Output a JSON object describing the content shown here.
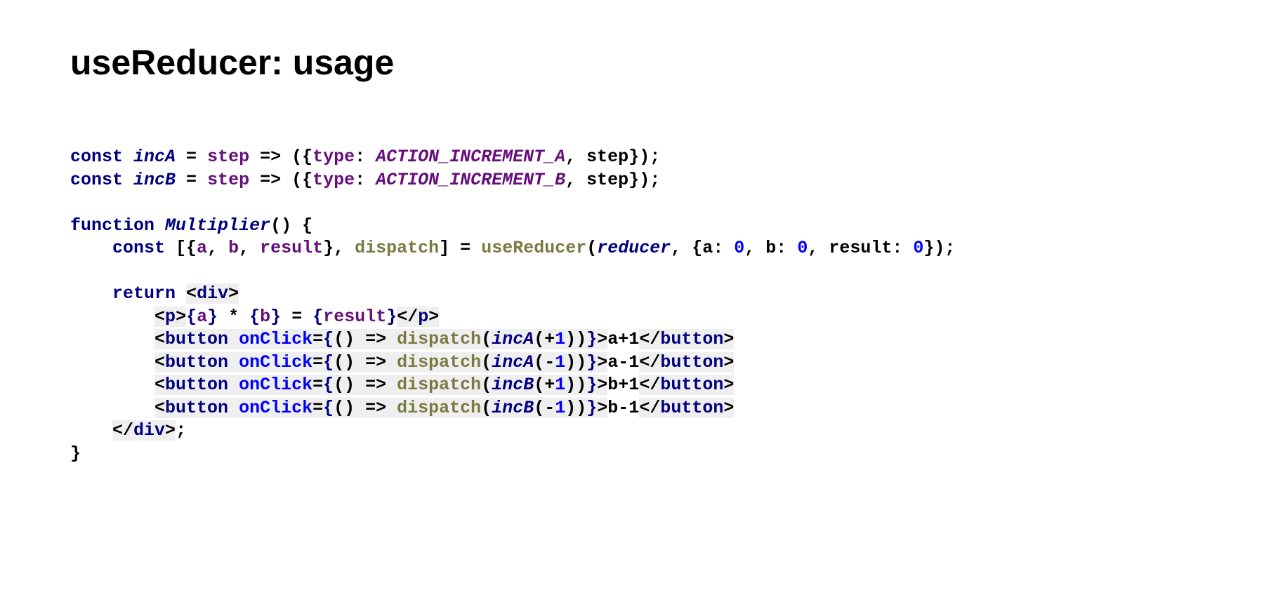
{
  "title": "useReducer: usage",
  "code": {
    "l1": {
      "const": "const",
      "fn": "incA",
      "eq": " = ",
      "param": "step",
      "arrow": " => ({",
      "type": "type",
      "colon": ": ",
      "action": "ACTION_INCREMENT_A",
      "rest": ", step});"
    },
    "l2": {
      "const": "const",
      "fn": "incB",
      "eq": " = ",
      "param": "step",
      "arrow": " => ({",
      "type": "type",
      "colon": ": ",
      "action": "ACTION_INCREMENT_B",
      "rest": ", step});"
    },
    "l4": {
      "function": "function",
      "name": "Multiplier",
      "after": "() {"
    },
    "l5": {
      "indent": "    ",
      "const": "const",
      "open": " [{",
      "a": "a",
      "c1": ", ",
      "b": "b",
      "c2": ", ",
      "result": "result",
      "close": "}, ",
      "dispatch": "dispatch",
      "eq": "] = ",
      "useReducer": "useReducer",
      "lp": "(",
      "reducer": "reducer",
      "c3": ", {a: ",
      "n0a": "0",
      "c4": ", b: ",
      "n0b": "0",
      "c5": ", result: ",
      "n0c": "0",
      "rp": "});"
    },
    "l7": {
      "indent": "    ",
      "return": "return",
      "sp": " ",
      "lt": "<",
      "div": "div",
      "gt": ">"
    },
    "l8": {
      "indent": "        ",
      "lt1": "<",
      "p": "p",
      "gt1": ">",
      "ob1": "{",
      "a": "a",
      "cb1": "}",
      "star": " * ",
      "ob2": "{",
      "b": "b",
      "cb2": "}",
      "eq": " = ",
      "ob3": "{",
      "result": "result",
      "cb3": "}",
      "lt2": "</",
      "p2": "p",
      "gt2": ">"
    },
    "btn1": {
      "indent": "        ",
      "lt": "<",
      "button": "button",
      "sp": " ",
      "onClick": "onClick",
      "eq": "=",
      "ob": "{",
      "arrow": "() => ",
      "dispatch": "dispatch",
      "lp": "(",
      "fn": "incA",
      "lp2": "(+",
      "num": "1",
      "rp": "))",
      "cb": "}",
      "gt": ">",
      "label": "a+1",
      "lt2": "</",
      "button2": "button",
      "gt2": ">"
    },
    "btn2": {
      "indent": "        ",
      "lt": "<",
      "button": "button",
      "sp": " ",
      "onClick": "onClick",
      "eq": "=",
      "ob": "{",
      "arrow": "() => ",
      "dispatch": "dispatch",
      "lp": "(",
      "fn": "incA",
      "lp2": "(-",
      "num": "1",
      "rp": "))",
      "cb": "}",
      "gt": ">",
      "label": "a-1",
      "lt2": "</",
      "button2": "button",
      "gt2": ">"
    },
    "btn3": {
      "indent": "        ",
      "lt": "<",
      "button": "button",
      "sp": " ",
      "onClick": "onClick",
      "eq": "=",
      "ob": "{",
      "arrow": "() => ",
      "dispatch": "dispatch",
      "lp": "(",
      "fn": "incB",
      "lp2": "(+",
      "num": "1",
      "rp": "))",
      "cb": "}",
      "gt": ">",
      "label": "b+1",
      "lt2": "</",
      "button2": "button",
      "gt2": ">"
    },
    "btn4": {
      "indent": "        ",
      "lt": "<",
      "button": "button",
      "sp": " ",
      "onClick": "onClick",
      "eq": "=",
      "ob": "{",
      "arrow": "() => ",
      "dispatch": "dispatch",
      "lp": "(",
      "fn": "incB",
      "lp2": "(-",
      "num": "1",
      "rp": "))",
      "cb": "}",
      "gt": ">",
      "label": "b-1",
      "lt2": "</",
      "button2": "button",
      "gt2": ">"
    },
    "l13": {
      "indent": "    ",
      "lt": "</",
      "div": "div",
      "gt": ">",
      "semi": ";"
    },
    "l14": {
      "brace": "}"
    }
  }
}
